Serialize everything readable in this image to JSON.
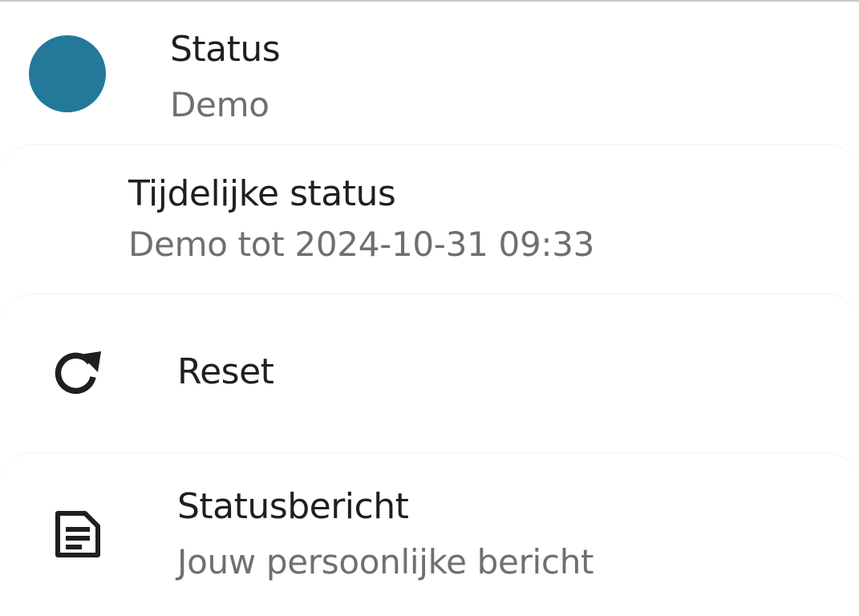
{
  "status": {
    "title": "Status",
    "value": "Demo",
    "dot_color": "#23799a"
  },
  "temporary_status": {
    "title": "Tijdelijke status",
    "value": "Demo tot 2024-10-31 09:33"
  },
  "reset": {
    "label": "Reset",
    "icon": "refresh-icon"
  },
  "status_message": {
    "title": "Statusbericht",
    "value": "Jouw persoonlijke bericht",
    "icon": "note-icon"
  }
}
